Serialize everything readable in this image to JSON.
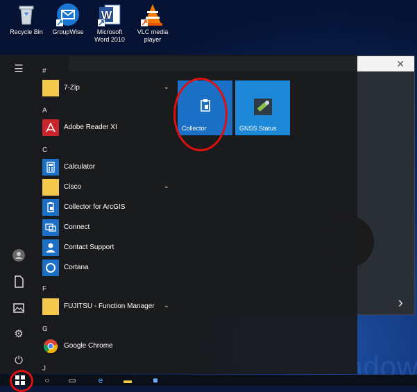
{
  "desktop": {
    "icons": [
      {
        "label": "Recycle Bin",
        "icon": "recycle-bin-icon"
      },
      {
        "label": "GroupWise",
        "icon": "groupwise-icon"
      },
      {
        "label": "Microsoft\nWord 2010",
        "icon": "word-icon"
      },
      {
        "label": "VLC media\nplayer",
        "icon": "vlc-icon"
      }
    ],
    "watermark": "Window"
  },
  "start_menu": {
    "rail_icons": [
      "hamburger-menu-icon",
      "user-avatar-icon",
      "documents-icon",
      "pictures-icon",
      "settings-icon",
      "power-icon"
    ],
    "sections": [
      {
        "letter": "#",
        "apps": [
          {
            "name": "7-Zip",
            "icon": "folder-icon",
            "expandable": true
          }
        ]
      },
      {
        "letter": "A",
        "apps": [
          {
            "name": "Adobe Reader XI",
            "icon": "adobe-reader-icon"
          }
        ]
      },
      {
        "letter": "C",
        "apps": [
          {
            "name": "Calculator",
            "icon": "calculator-icon"
          },
          {
            "name": "Cisco",
            "icon": "folder-icon",
            "expandable": true
          },
          {
            "name": "Collector for ArcGIS",
            "icon": "collector-icon"
          },
          {
            "name": "Connect",
            "icon": "connect-icon"
          },
          {
            "name": "Contact Support",
            "icon": "contact-support-icon"
          },
          {
            "name": "Cortana",
            "icon": "cortana-icon"
          }
        ]
      },
      {
        "letter": "F",
        "apps": [
          {
            "name": "FUJITSU - Function Manager",
            "icon": "folder-icon",
            "expandable": true
          }
        ]
      },
      {
        "letter": "G",
        "apps": [
          {
            "name": "Google Chrome",
            "icon": "chrome-icon"
          }
        ]
      },
      {
        "letter": "J",
        "apps": []
      }
    ],
    "tiles": [
      {
        "name": "Collector",
        "icon": "collector-icon",
        "color": "#1b6fc4"
      },
      {
        "name": "GNSS Status",
        "icon": "gnss-status-icon",
        "color": "#1e88d8"
      }
    ]
  },
  "taskbar": {
    "items": [
      "start-button-icon",
      "search-icon",
      "task-view-icon",
      "internet-explorer-icon",
      "file-explorer-icon",
      "app-icon"
    ]
  }
}
